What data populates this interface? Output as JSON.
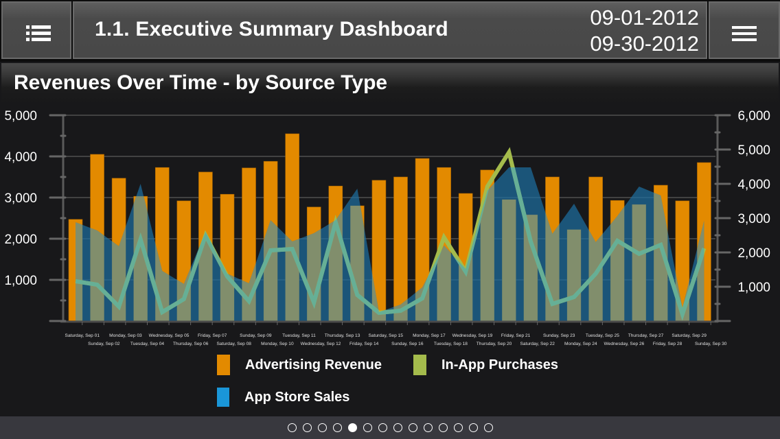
{
  "header": {
    "title": "1.1. Executive Summary Dashboard",
    "date_start": "09-01-2012",
    "date_end": "09-30-2012",
    "left_button_icon": "list-icon",
    "right_button_icon": "hamburger-menu-icon"
  },
  "chart_panel": {
    "title": "Revenues Over Time - by Source Type"
  },
  "legend": [
    {
      "label": "Advertising Revenue",
      "color": "#e38a00"
    },
    {
      "label": "In-App Purchases",
      "color": "#a4bb4c"
    },
    {
      "label": "App Store Sales",
      "color": "#1a96d8"
    }
  ],
  "pager": {
    "count": 14,
    "active_index": 4
  },
  "chart_data": {
    "type": "bar",
    "title": "Revenues Over Time - by Source Type",
    "xlabel": "",
    "ylabel": "",
    "grid": true,
    "legend_position": "bottom",
    "categories": [
      "Saturday, Sep 01",
      "Sunday, Sep 02",
      "Monday, Sep 03",
      "Tuesday, Sep 04",
      "Wednesday, Sep 05",
      "Thursday, Sep 06",
      "Friday, Sep 07",
      "Saturday, Sep 08",
      "Sunday, Sep 09",
      "Monday, Sep 10",
      "Tuesday, Sep 11",
      "Wednesday, Sep 12",
      "Thursday, Sep 13",
      "Friday, Sep 14",
      "Saturday, Sep 15",
      "Sunday, Sep 16",
      "Monday, Sep 17",
      "Tuesday, Sep 18",
      "Wednesday, Sep 19",
      "Thursday, Sep 20",
      "Friday, Sep 21",
      "Saturday, Sep 22",
      "Sunday, Sep 23",
      "Monday, Sep 24",
      "Tuesday, Sep 25",
      "Wednesday, Sep 26",
      "Thursday, Sep 27",
      "Friday, Sep 28",
      "Saturday, Sep 29",
      "Sunday, Sep 30"
    ],
    "y_left": {
      "min": 0,
      "max": 5000,
      "ticks": [
        0,
        1000,
        2000,
        3000,
        4000,
        5000
      ],
      "tick_labels": [
        "",
        "1,000",
        "2,000",
        "3,000",
        "4,000",
        "5,000"
      ]
    },
    "y_right": {
      "min": 0,
      "max": 6000,
      "ticks": [
        0,
        1000,
        2000,
        3000,
        4000,
        5000,
        6000
      ],
      "tick_labels": [
        "",
        "1,000",
        "2,000",
        "3,000",
        "4,000",
        "5,000",
        "6,000"
      ]
    },
    "series": [
      {
        "name": "Advertising Revenue",
        "kind": "bar",
        "axis": "left",
        "color": "#e38a00",
        "values": [
          2470,
          4050,
          3470,
          3030,
          3730,
          2920,
          3620,
          3080,
          3720,
          3880,
          4550,
          2770,
          3280,
          2800,
          3420,
          3500,
          3950,
          3730,
          3100,
          3670,
          2950,
          2580,
          3500,
          2220,
          3500,
          2930,
          2830,
          3300,
          2920,
          3850
        ]
      },
      {
        "name": "App Store Sales",
        "kind": "area",
        "axis": "right",
        "color": "#1a96d8",
        "values": [
          2880,
          2640,
          2180,
          4000,
          1460,
          1080,
          2600,
          1380,
          1100,
          2940,
          2320,
          2560,
          2940,
          3860,
          260,
          480,
          980,
          2200,
          1520,
          3800,
          4480,
          4480,
          2540,
          3420,
          2300,
          3060,
          3920,
          3660,
          380,
          2920
        ]
      },
      {
        "name": "In-App Purchases",
        "kind": "line",
        "axis": "right",
        "color": "#a4bb4c",
        "values": [
          1160,
          1060,
          420,
          2380,
          260,
          640,
          2500,
          1300,
          580,
          2060,
          2100,
          540,
          2880,
          760,
          240,
          300,
          660,
          2440,
          1440,
          3920,
          4920,
          2320,
          500,
          700,
          1380,
          2340,
          1960,
          2220,
          200,
          2120
        ]
      }
    ]
  }
}
